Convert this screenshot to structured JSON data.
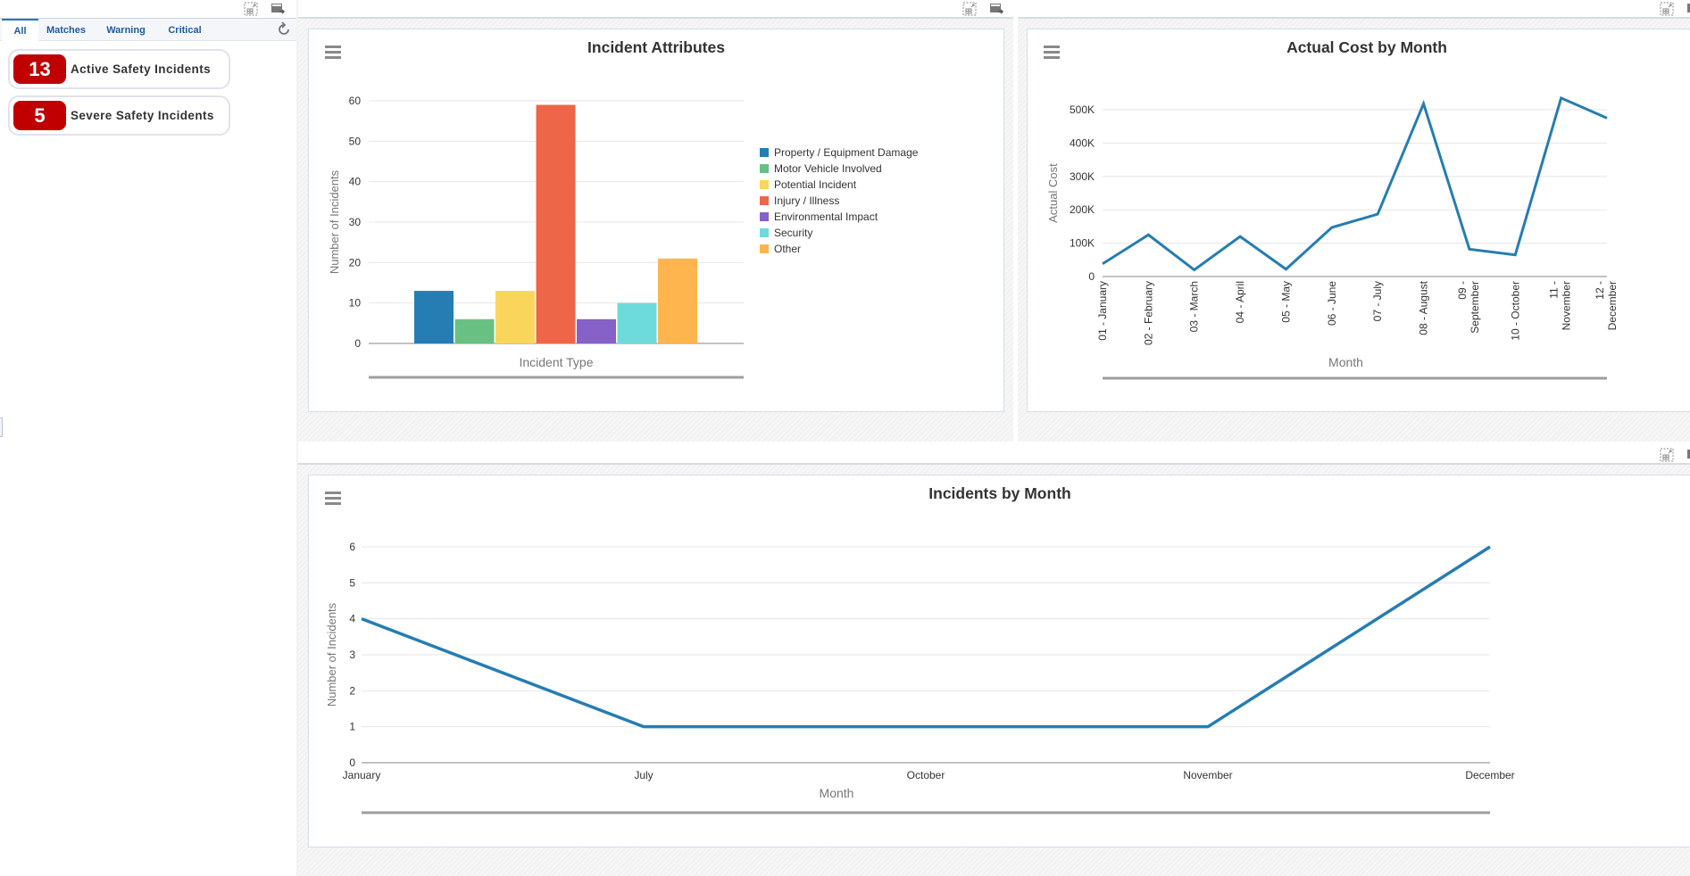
{
  "left_panel": {
    "tabs": [
      {
        "label": "All",
        "active": true
      },
      {
        "label": "Matches",
        "active": false
      },
      {
        "label": "Warning",
        "active": false
      },
      {
        "label": "Critical",
        "active": false
      }
    ],
    "kpis": [
      {
        "value": "13",
        "label": "Active Safety Incidents",
        "color": "#c00000"
      },
      {
        "value": "5",
        "label": "Severe Safety Incidents",
        "color": "#c00000"
      }
    ],
    "icons": {
      "maximize": "maximize-grid-icon",
      "export": "export-table-icon",
      "refresh": "refresh-icon"
    }
  },
  "panes": {
    "incident_attributes": {
      "title": "Incident Attributes",
      "menu_icon": "hamburger-menu-icon"
    },
    "actual_cost": {
      "title": "Actual Cost by Month",
      "menu_icon": "hamburger-menu-icon"
    },
    "incidents_by_month": {
      "title": "Incidents by Month",
      "menu_icon": "hamburger-menu-icon"
    }
  },
  "chart_data": [
    {
      "id": "incident_attributes",
      "type": "bar",
      "title": "Incident Attributes",
      "xlabel": "Incident Type",
      "ylabel": "Number of Incidents",
      "ylim": [
        0,
        60
      ],
      "yticks": [
        "0",
        "10",
        "20",
        "30",
        "40",
        "50",
        "60"
      ],
      "grid": true,
      "legend_position": "right",
      "series": [
        {
          "name": "Property / Equipment Damage",
          "value": 13,
          "color": "#267db3"
        },
        {
          "name": "Motor Vehicle Involved",
          "value": 6,
          "color": "#68c182"
        },
        {
          "name": "Potential Incident",
          "value": 13,
          "color": "#fad55c"
        },
        {
          "name": "Injury / Illness",
          "value": 59,
          "color": "#ed6647"
        },
        {
          "name": "Environmental Impact",
          "value": 6,
          "color": "#8561c8"
        },
        {
          "name": "Security",
          "value": 10,
          "color": "#6ddbdb"
        },
        {
          "name": "Other",
          "value": 21,
          "color": "#ffb54d"
        }
      ]
    },
    {
      "id": "actual_cost",
      "type": "line",
      "title": "Actual Cost by Month",
      "xlabel": "Month",
      "ylabel": "Actual Cost",
      "ylim": [
        0,
        500000
      ],
      "yticks": [
        "0",
        "100K",
        "200K",
        "300K",
        "400K",
        "500K"
      ],
      "grid": true,
      "color": "#267db3",
      "categories": [
        [
          "01 - January"
        ],
        [
          "02 - February"
        ],
        [
          "03 - March"
        ],
        [
          "04 - April"
        ],
        [
          "05 - May"
        ],
        [
          "06 - June"
        ],
        [
          "07 - July"
        ],
        [
          "08 - August"
        ],
        [
          "09 -",
          "September"
        ],
        [
          "10 - October"
        ],
        [
          "11 -",
          "November"
        ],
        [
          "12 -",
          "December"
        ]
      ],
      "values": [
        38000,
        125000,
        20000,
        120000,
        22000,
        147000,
        187000,
        518000,
        82000,
        65000,
        535000,
        475000
      ]
    },
    {
      "id": "incidents_by_month",
      "type": "line",
      "title": "Incidents by Month",
      "xlabel": "Month",
      "ylabel": "Number of Incidents",
      "ylim": [
        0,
        6
      ],
      "yticks": [
        "0",
        "1",
        "2",
        "3",
        "4",
        "5",
        "6"
      ],
      "grid": true,
      "color": "#267db3",
      "categories": [
        "January",
        "July",
        "October",
        "November",
        "December"
      ],
      "values": [
        4,
        1,
        1,
        1,
        6
      ]
    }
  ]
}
